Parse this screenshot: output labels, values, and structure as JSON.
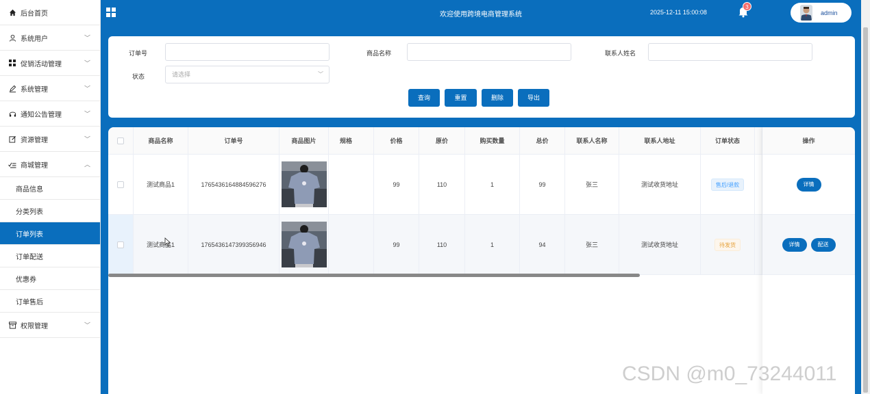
{
  "sidebar": {
    "items": [
      {
        "label": "后台首页",
        "icon": "home-icon"
      },
      {
        "label": "系统用户",
        "icon": "user-icon"
      },
      {
        "label": "促销活动管理",
        "icon": "grid-icon"
      },
      {
        "label": "系统管理",
        "icon": "pen-icon"
      },
      {
        "label": "通知公告管理",
        "icon": "headset-icon"
      },
      {
        "label": "资源管理",
        "icon": "edit-icon"
      },
      {
        "label": "商城管理",
        "icon": "check-list-icon"
      }
    ],
    "mall_sub": [
      "商品信息",
      "分类列表",
      "订单列表",
      "订单配送",
      "优惠券",
      "订单售后"
    ],
    "active_sub": "订单列表",
    "last_item": {
      "label": "权限管理",
      "icon": "archive-icon"
    }
  },
  "header": {
    "title": "欢迎使用跨境电商管理系统",
    "datetime": "2025-12-11 15:00:08",
    "notification_count": "3",
    "username": "admin"
  },
  "search": {
    "order_no_label": "订单号",
    "product_name_label": "商品名称",
    "contact_name_label": "联系人姓名",
    "status_label": "状态",
    "status_placeholder": "请选择",
    "buttons": {
      "query": "查询",
      "reset": "重置",
      "delete": "删除",
      "export": "导出"
    }
  },
  "table": {
    "columns": [
      "商品名称",
      "订单号",
      "商品图片",
      "规格",
      "价格",
      "原价",
      "购买数量",
      "总价",
      "联系人名称",
      "联系人地址",
      "订单状态",
      "操作"
    ],
    "rows": [
      {
        "product": "测试商品1",
        "order_no": "1765436164884596276",
        "spec": "",
        "price": "99",
        "orig_price": "110",
        "qty": "1",
        "total": "99",
        "contact": "张三",
        "address": "测试收货地址",
        "status": "售后/退款",
        "status_color": "#409eff",
        "actions": [
          "详情"
        ]
      },
      {
        "product": "测试商品1",
        "order_no": "1765436147399356946",
        "spec": "",
        "price": "99",
        "orig_price": "110",
        "qty": "1",
        "total": "94",
        "contact": "张三",
        "address": "测试收货地址",
        "status": "待发货",
        "status_color": "#e6a23c",
        "actions": [
          "详情",
          "配送"
        ]
      }
    ]
  },
  "watermark": "CSDN @m0_73244011",
  "colors": {
    "primary": "#0a6ebd"
  }
}
